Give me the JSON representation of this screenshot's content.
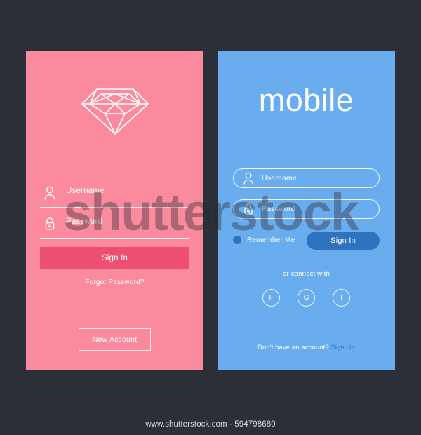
{
  "colors": {
    "background": "#2b2f38",
    "pink_panel": "#fc8a9e",
    "pink_accent": "#ec4f71",
    "blue_panel": "#6aadee",
    "blue_accent": "#2e73bd",
    "white": "#ffffff",
    "footer_text": "#d7d9de"
  },
  "pink_screen": {
    "logo_icon": "diamond-icon",
    "username": {
      "icon": "user-icon",
      "placeholder": "Username",
      "value": ""
    },
    "password": {
      "icon": "lock-icon",
      "placeholder": "Password",
      "value": ""
    },
    "sign_in_label": "Sign In",
    "forgot_password_label": "Forgot Password?",
    "new_account_label": "New Account"
  },
  "blue_screen": {
    "title": "mobile",
    "username": {
      "icon": "user-icon",
      "placeholder": "Username",
      "value": ""
    },
    "password": {
      "icon": "lock-icon",
      "placeholder": "Password",
      "value": ""
    },
    "remember_me_label": "Remember Me",
    "remember_me_checked": true,
    "sign_in_label": "Sign In",
    "divider_label": "or connect with",
    "social_buttons": [
      {
        "label": "F",
        "name": "facebook"
      },
      {
        "label": "G",
        "name": "google"
      },
      {
        "label": "T",
        "name": "twitter"
      }
    ],
    "bottom_question": "Don't have an account?",
    "bottom_action": "Sign Up"
  },
  "watermark": {
    "text": "shutterstock"
  },
  "footer": {
    "text": "www.shutterstock.com · 594798680"
  }
}
